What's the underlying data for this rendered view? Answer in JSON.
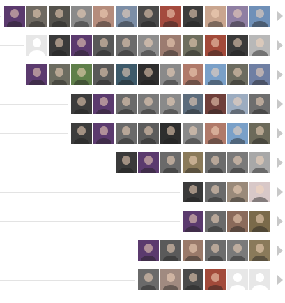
{
  "colors": {
    "background": "#ffffff",
    "row_line": "#e3e3e3",
    "expand_arrow": "#c8c8c8",
    "blank_avatar": "#e7e7e7"
  },
  "icons": {
    "expand": "triangle-right-icon",
    "placeholder_avatar": "person-silhouette-icon"
  },
  "rows": [
    {
      "avatars": [
        "#5b3a6e",
        "#6f6a62",
        "#54524c",
        "#8a8a8a",
        "#b58c7c",
        "#7c8ea6",
        "#4a4a4a",
        "#a44a3e",
        "#3c3c3c",
        "#c9a58f",
        "#8f7fa3",
        "#6f90b8"
      ]
    },
    {
      "avatars": [
        "blank",
        "#3a3a3a",
        "#5b3a6e",
        "#585858",
        "#6c6c6c",
        "#8e8e8e",
        "#9c7c70",
        "#6e6e5e",
        "#a24a3a",
        "#3a3a3a",
        "#b8b8b8"
      ]
    },
    {
      "avatars": [
        "#5b3a6e",
        "#6c6c60",
        "#5f7f4a",
        "#585858",
        "#3d5a6a",
        "#2e2e2e",
        "#8a8a8a",
        "#b07a6a",
        "#7aa0c8",
        "#6c6c60",
        "#6f7fa3"
      ]
    },
    {
      "avatars": [
        "#3c3c3c",
        "#5b3a6e",
        "#6a6a6a",
        "#7a7a7a",
        "#8a8a8a",
        "#5c6c7c",
        "#6f3f3a",
        "#9cacc0",
        "#6e6e6e"
      ]
    },
    {
      "avatars": [
        "#3c3c3c",
        "#5b3a6e",
        "#6a6a6a",
        "#5c5c5c",
        "#2e2e2e",
        "#8a8a8a",
        "#b07a6a",
        "#7aa0c8",
        "#6c6a5a"
      ]
    },
    {
      "avatars": [
        "#3a3a3a",
        "#5b3a6e",
        "#6a6a6a",
        "#8a7a5a",
        "#6c6c6c",
        "#7a7a7a",
        "#a8a8a8"
      ]
    },
    {
      "avatars": [
        "#3a3a3a",
        "#6a6a6a",
        "#9a8a7a",
        "#d8c8c8"
      ]
    },
    {
      "avatars": [
        "#5b3a6e",
        "#6a6a6a",
        "#8a6a5a",
        "#7a6a4a"
      ]
    },
    {
      "avatars": [
        "#5b3a6e",
        "#5a5a5a",
        "#9a7a6a",
        "#6c6c6c",
        "#7a7a7a",
        "#8a7a5a"
      ]
    },
    {
      "avatars": [
        "#6a6a6a",
        "#a08a80",
        "#4a4a4a",
        "#a24a3a",
        "blank",
        "blank"
      ]
    }
  ]
}
